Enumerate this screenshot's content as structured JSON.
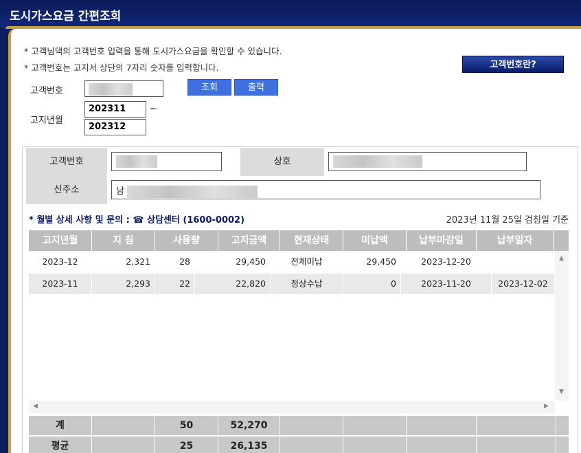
{
  "title": "도시가스요금 간편조회",
  "notices": [
    "* 고객님댁의 고객번호 입력을 통해 도시가스요금을 확인할 수 있습니다.",
    "* 고객번호는 고지서 상단의 7자리 숫자를 입력합니다."
  ],
  "what_is_button": "고객번호란?",
  "form": {
    "customer_no_label": "고객번호",
    "customer_no_value": "",
    "period_label": "고지년월",
    "period_from": "202311",
    "period_sep": "~",
    "period_to": "202312",
    "search_button": "조회",
    "print_button": "출력"
  },
  "info": {
    "customer_no_label": "고객번호",
    "customer_no_value": "",
    "company_label": "상호",
    "company_value": "",
    "address_label": "신주소",
    "address_value": "남"
  },
  "section": {
    "title": "* 월별 상세 사항 및 문의 : ☎ 상담센터 (1600-0002)",
    "basis": "2023년 11월 25일 검침일 기준"
  },
  "table": {
    "columns": [
      "고지년월",
      "지 침",
      "사용량",
      "고지금액",
      "현재상태",
      "미납액",
      "납부마감일",
      "납부일자"
    ],
    "rows": [
      [
        "2023-12",
        "2,321",
        "28",
        "29,450",
        "전체미납",
        "29,450",
        "2023-12-20",
        ""
      ],
      [
        "2023-11",
        "2,293",
        "22",
        "22,820",
        "정상수납",
        "0",
        "2023-11-20",
        "2023-12-02"
      ]
    ],
    "summary": [
      {
        "label": "계",
        "usage": "50",
        "amount": "52,270"
      },
      {
        "label": "평균",
        "usage": "25",
        "amount": "26,135"
      }
    ]
  },
  "colors": {
    "header_bg": "#0d1f5c",
    "accent_gold": "#c8a040",
    "button_blue": "#3f6fe0",
    "table_header": "#bdbdbd"
  }
}
